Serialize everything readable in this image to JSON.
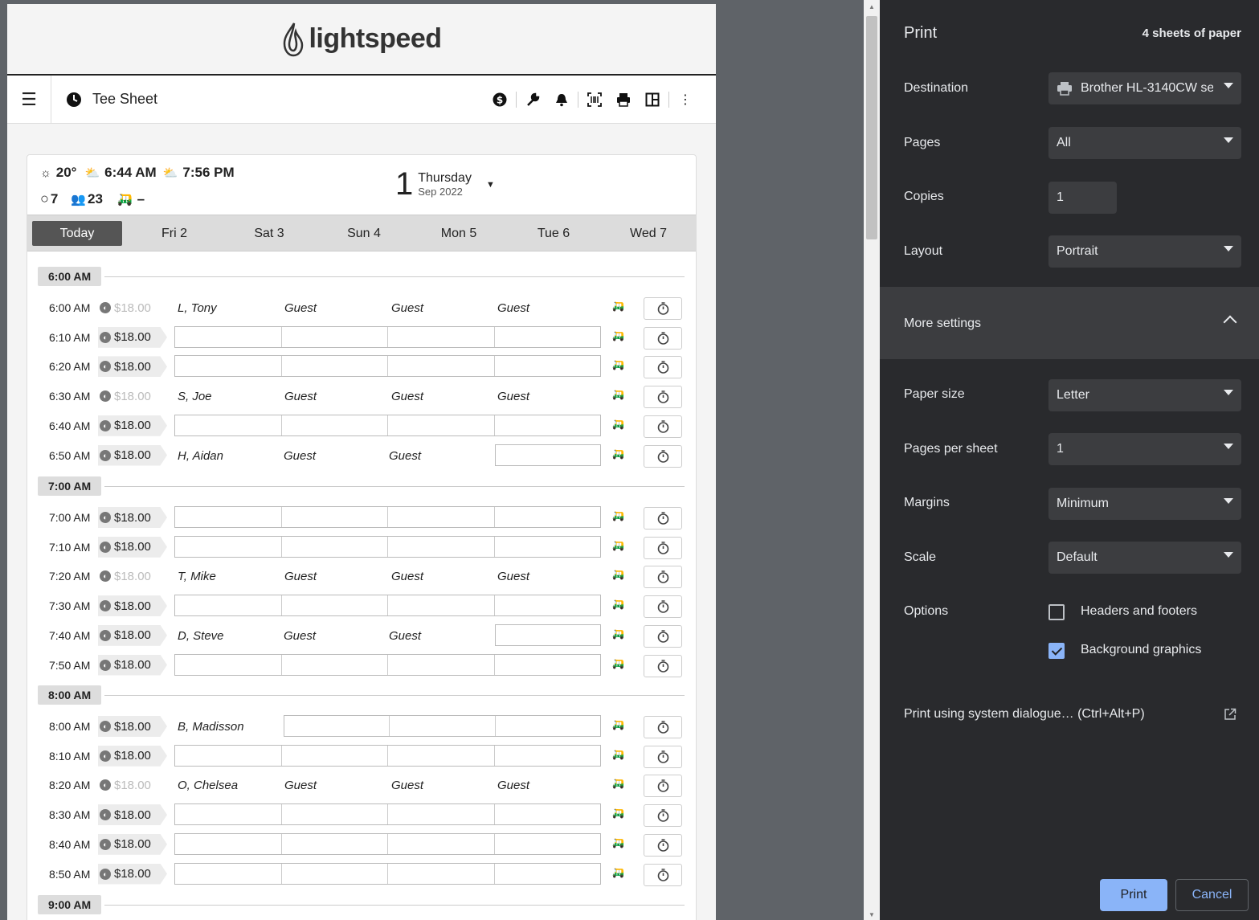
{
  "preview": {
    "logo_text": "lightspeed",
    "app_title": "Tee Sheet",
    "weather": {
      "temp": "20°",
      "sunrise": "6:44 AM",
      "sunset": "7:56 PM",
      "rounds": "7",
      "players": "23",
      "carts": "–"
    },
    "date": {
      "day_num": "1",
      "day_name": "Thursday",
      "month_year": "Sep 2022"
    },
    "day_tabs": [
      "Today",
      "Fri 2",
      "Sat 3",
      "Sun 4",
      "Mon 5",
      "Tue 6",
      "Wed 7"
    ],
    "hours": [
      "6:00 AM",
      "7:00 AM",
      "8:00 AM",
      "9:00 AM"
    ],
    "rows": [
      {
        "time": "6:00 AM",
        "price": "$18.00",
        "booked": true,
        "players": [
          "L, Tony",
          "Guest",
          "Guest",
          "Guest"
        ]
      },
      {
        "time": "6:10 AM",
        "price": "$18.00",
        "booked": false,
        "players": []
      },
      {
        "time": "6:20 AM",
        "price": "$18.00",
        "booked": false,
        "players": []
      },
      {
        "time": "6:30 AM",
        "price": "$18.00",
        "booked": true,
        "players": [
          "S, Joe",
          "Guest",
          "Guest",
          "Guest"
        ]
      },
      {
        "time": "6:40 AM",
        "price": "$18.00",
        "booked": false,
        "players": []
      },
      {
        "time": "6:50 AM",
        "price": "$18.00",
        "booked": false,
        "players": [
          "H, Aidan",
          "Guest",
          "Guest"
        ]
      },
      {
        "time": "7:00 AM",
        "price": "$18.00",
        "booked": false,
        "players": []
      },
      {
        "time": "7:10 AM",
        "price": "$18.00",
        "booked": false,
        "players": []
      },
      {
        "time": "7:20 AM",
        "price": "$18.00",
        "booked": true,
        "players": [
          "T, Mike",
          "Guest",
          "Guest",
          "Guest"
        ]
      },
      {
        "time": "7:30 AM",
        "price": "$18.00",
        "booked": false,
        "players": []
      },
      {
        "time": "7:40 AM",
        "price": "$18.00",
        "booked": false,
        "players": [
          "D, Steve",
          "Guest",
          "Guest"
        ]
      },
      {
        "time": "7:50 AM",
        "price": "$18.00",
        "booked": false,
        "players": []
      },
      {
        "time": "8:00 AM",
        "price": "$18.00",
        "booked": false,
        "players": [
          "B, Madisson"
        ]
      },
      {
        "time": "8:10 AM",
        "price": "$18.00",
        "booked": false,
        "players": []
      },
      {
        "time": "8:20 AM",
        "price": "$18.00",
        "booked": true,
        "players": [
          "O, Chelsea",
          "Guest",
          "Guest",
          "Guest"
        ]
      },
      {
        "time": "8:30 AM",
        "price": "$18.00",
        "booked": false,
        "players": []
      },
      {
        "time": "8:40 AM",
        "price": "$18.00",
        "booked": false,
        "players": []
      },
      {
        "time": "8:50 AM",
        "price": "$18.00",
        "booked": false,
        "players": []
      }
    ]
  },
  "print_panel": {
    "title": "Print",
    "sheets": "4 sheets of paper",
    "destination_label": "Destination",
    "destination_value": "Brother HL-3140CW se",
    "pages_label": "Pages",
    "pages_value": "All",
    "copies_label": "Copies",
    "copies_value": "1",
    "layout_label": "Layout",
    "layout_value": "Portrait",
    "more_settings_label": "More settings",
    "paper_size_label": "Paper size",
    "paper_size_value": "Letter",
    "pages_per_sheet_label": "Pages per sheet",
    "pages_per_sheet_value": "1",
    "margins_label": "Margins",
    "margins_value": "Minimum",
    "scale_label": "Scale",
    "scale_value": "Default",
    "options_label": "Options",
    "headers_footers_label": "Headers and footers",
    "headers_footers_checked": false,
    "background_graphics_label": "Background graphics",
    "background_graphics_checked": true,
    "system_dialog_label": "Print using system dialogue… (Ctrl+Alt+P)",
    "print_button": "Print",
    "cancel_button": "Cancel"
  },
  "colors": {
    "panel_bg": "#292a2d",
    "accent": "#8ab4f8",
    "active_tab": "#555555"
  }
}
